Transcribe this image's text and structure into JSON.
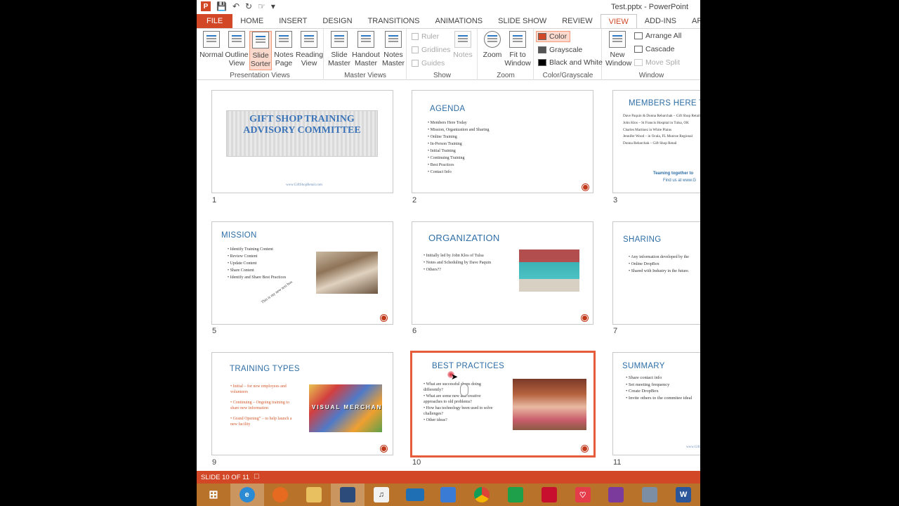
{
  "window": {
    "title": "Test.pptx - PowerPoint"
  },
  "tabs": [
    "FILE",
    "HOME",
    "INSERT",
    "DESIGN",
    "TRANSITIONS",
    "ANIMATIONS",
    "SLIDE SHOW",
    "REVIEW",
    "VIEW",
    "ADD-INS",
    "ARTICULATE"
  ],
  "active_tab": "VIEW",
  "ribbon": {
    "presentation_views": {
      "label": "Presentation Views",
      "normal": "Normal",
      "outline": "Outline View",
      "slide_sorter": "Slide Sorter",
      "notes_page": "Notes Page",
      "reading_view": "Reading View"
    },
    "master_views": {
      "label": "Master Views",
      "slide_master": "Slide Master",
      "handout_master": "Handout Master",
      "notes_master": "Notes Master"
    },
    "show": {
      "label": "Show",
      "ruler": "Ruler",
      "gridlines": "Gridlines",
      "guides": "Guides",
      "notes": "Notes"
    },
    "zoom": {
      "label": "Zoom",
      "zoom": "Zoom",
      "fit": "Fit to Window"
    },
    "color": {
      "label": "Color/Grayscale",
      "color": "Color",
      "grayscale": "Grayscale",
      "bw": "Black and White"
    },
    "window": {
      "label": "Window",
      "new_window": "New Window",
      "arrange": "Arrange All",
      "cascade": "Cascade",
      "move_split": "Move Split"
    }
  },
  "slides": {
    "s1": {
      "num": "1",
      "title": "GIFT SHOP TRAINING ADVISORY COMMITTEE",
      "footer": "www.GiftShopRetail.com"
    },
    "s2": {
      "num": "2",
      "title": "AGENDA",
      "bullets": [
        "Members Here Today",
        "Mission, Organization and Sharing",
        "Online Training",
        "In-Person Training",
        "Initial Training",
        "Continuing Training",
        "Best Practices",
        "Contact Info"
      ]
    },
    "s3": {
      "num": "3",
      "title": "MEMBERS HERE TODAY",
      "lines": [
        "Dave Paquin & Donna Rebarchak – Gift Shop Retail",
        "John Klos – St Francis Hospital in Tulsa, OK",
        "Charles Martinez in White Plains",
        "Jennifer Wood – in Ocala, FL Munroe Regional",
        "Donna Rebarchak – Gift Shop Retail"
      ],
      "foot1": "Teaming together to",
      "foot2": "Find us at www.G"
    },
    "s5": {
      "num": "5",
      "title": "MISSION",
      "bullets": [
        "Identify Training Content",
        "Review Content",
        "Update Content",
        "Share Content",
        "Identify and Share Best Practices"
      ],
      "note": "This is my new text box"
    },
    "s6": {
      "num": "6",
      "title": "ORGANIZATION",
      "bullets": [
        "Initially led by John Klos of Tulsa",
        "Notes and Scheduling by Dave Paquin",
        "Others??"
      ]
    },
    "s7": {
      "num": "7",
      "title": "SHARING",
      "bullets": [
        "Any information developed by the",
        "Online DropBox",
        "Shared with Industry in the future."
      ]
    },
    "s9": {
      "num": "9",
      "title": "TRAINING TYPES",
      "bullets": [
        "Initial – for new employees and volunteers",
        "Continuing – Ongoing training to share new information",
        "Grand Opening” – to help launch a new facility"
      ],
      "photo_text": "VISUAL MERCHANDISING"
    },
    "s10": {
      "num": "10",
      "title": "BEST PRACTICES",
      "bullets": [
        "What are successful shops doing differently?",
        "What are some new and creative approaches to old problems?",
        "How has technology been used to solve challenges?",
        "Other ideas?"
      ]
    },
    "s11": {
      "num": "11",
      "title": "SUMMARY",
      "bullets": [
        "Share contact info",
        "Set meeting frequency",
        "Create DropBox",
        "Invite others to the commitee ideal"
      ],
      "footer": "www.Gift"
    }
  },
  "status": {
    "slide_info": "SLIDE 10 OF 11"
  },
  "colors": {
    "accent": "#d24726",
    "slide_title": "#2e6ea6",
    "taskbar": "#b8722a"
  },
  "taskbar_icons": [
    "windows-icon",
    "internet-explorer-icon",
    "firefox-icon",
    "file-explorer-icon",
    "floppy-icon",
    "app-icon",
    "lenovo-icon",
    "remote-desktop-icon",
    "chrome-icon",
    "store-icon",
    "nfl-icon",
    "health-icon",
    "onenote-icon",
    "tool-icon",
    "word-icon"
  ]
}
